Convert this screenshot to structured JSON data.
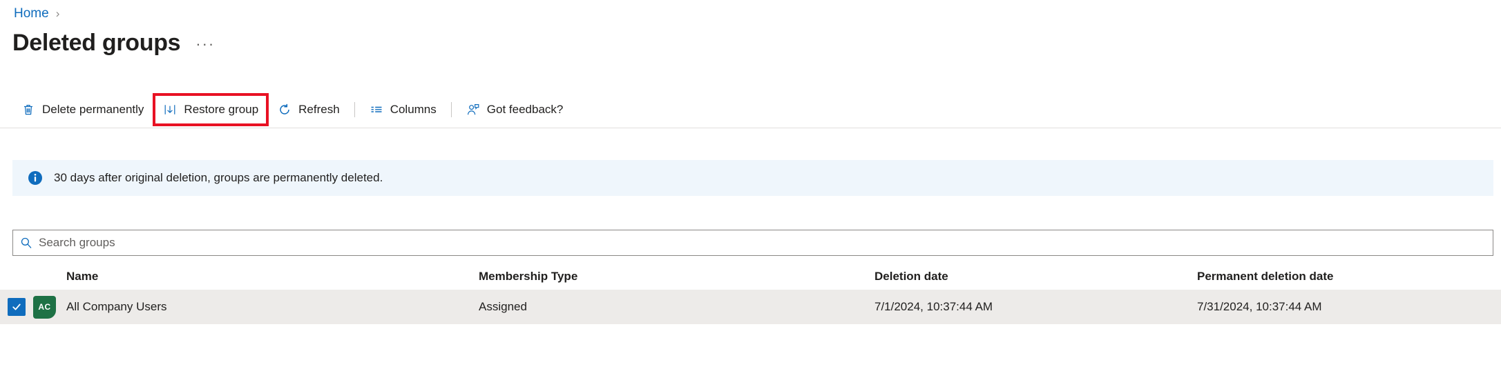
{
  "breadcrumb": {
    "home_label": "Home",
    "separator": "›"
  },
  "header": {
    "title": "Deleted groups",
    "more_label": "···"
  },
  "toolbar": {
    "delete_permanently_label": "Delete permanently",
    "restore_group_label": "Restore group",
    "refresh_label": "Refresh",
    "columns_label": "Columns",
    "got_feedback_label": "Got feedback?",
    "highlight_color": "#e81123",
    "icon_color": "#0f6cbd"
  },
  "banner": {
    "message": "30 days after original deletion, groups are permanently deleted.",
    "background": "#eff6fc",
    "icon_color": "#0f6cbd"
  },
  "search": {
    "placeholder": "Search groups",
    "value": ""
  },
  "table": {
    "columns": [
      "Name",
      "Membership Type",
      "Deletion date",
      "Permanent deletion date"
    ],
    "rows": [
      {
        "selected": true,
        "avatar_initials": "AC",
        "avatar_color": "#1e7145",
        "name": "All Company Users",
        "membership_type": "Assigned",
        "deletion_date": "7/1/2024, 10:37:44 AM",
        "permanent_deletion_date": "7/31/2024, 10:37:44 AM"
      }
    ]
  }
}
